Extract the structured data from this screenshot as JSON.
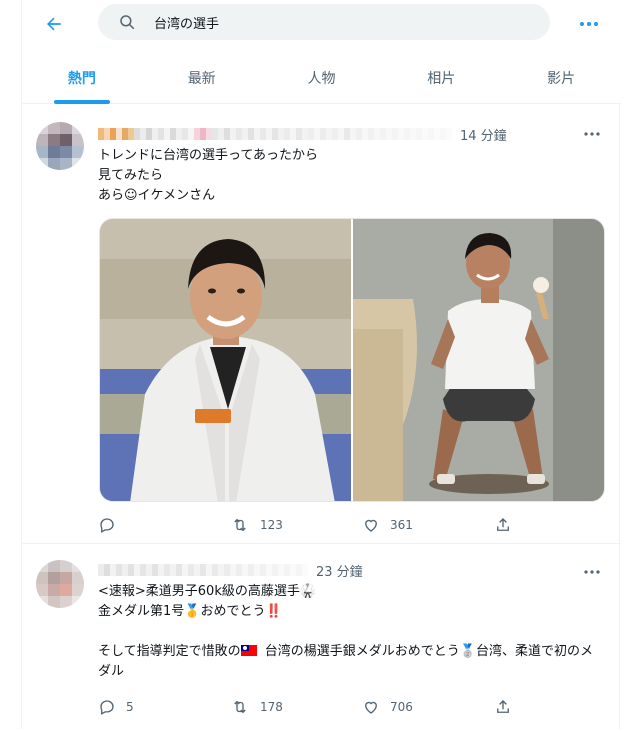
{
  "header": {
    "search_value": "台湾の選手",
    "tabs": [
      "熱門",
      "最新",
      "人物",
      "相片",
      "影片"
    ],
    "active_tab": 0
  },
  "colors": {
    "accent": "#1d9bf0",
    "secondary_text": "#536471",
    "border": "#eff3f4"
  },
  "icons": {
    "back": "arrow-left-icon",
    "search": "search-icon",
    "more": "more-dots-icon",
    "reply": "reply-icon",
    "retweet": "retweet-icon",
    "like": "heart-icon",
    "share": "share-icon"
  },
  "tweets": [
    {
      "time": "14 分鐘",
      "text": "トレンドに台湾の選手ってあったから\n見てみたら\nあら☺イケメンさん",
      "media_count": 2,
      "reply_count": "",
      "retweet_count": "123",
      "like_count": "361"
    },
    {
      "time": "23 分鐘",
      "text_part1": "<速報>柔道男子60k級の高藤選手🥋\n金メダル第1号🥇おめでとう‼️\n\nそして指導判定で惜敗の",
      "text_part2": " 台湾の楊選手銀メダルおめでとう🥈台湾、柔道で初のメダル",
      "reply_count": "5",
      "retweet_count": "178",
      "like_count": "706"
    }
  ]
}
